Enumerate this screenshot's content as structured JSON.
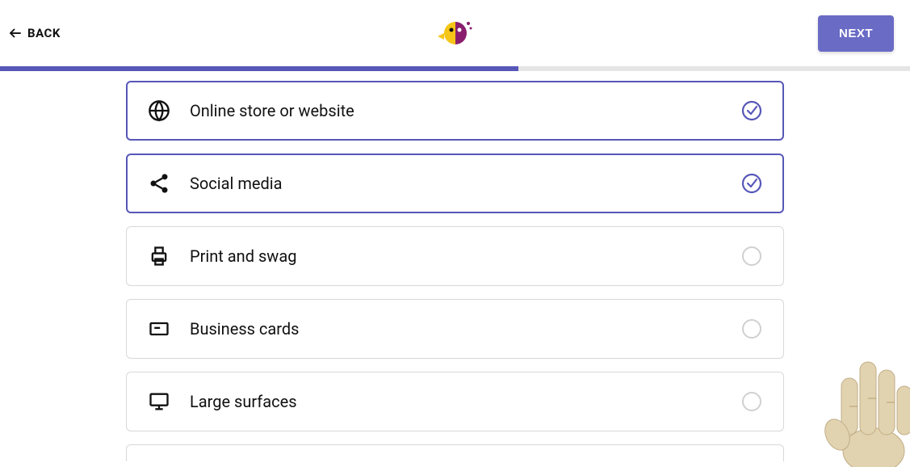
{
  "header": {
    "back_label": "BACK",
    "next_label": "NEXT"
  },
  "progress": {
    "percent": 57
  },
  "options": [
    {
      "icon": "globe-icon",
      "label": "Online store or website",
      "selected": true
    },
    {
      "icon": "share-icon",
      "label": "Social media",
      "selected": true
    },
    {
      "icon": "printer-icon",
      "label": "Print and swag",
      "selected": false
    },
    {
      "icon": "card-icon",
      "label": "Business cards",
      "selected": false
    },
    {
      "icon": "display-icon",
      "label": "Large surfaces",
      "selected": false
    }
  ]
}
